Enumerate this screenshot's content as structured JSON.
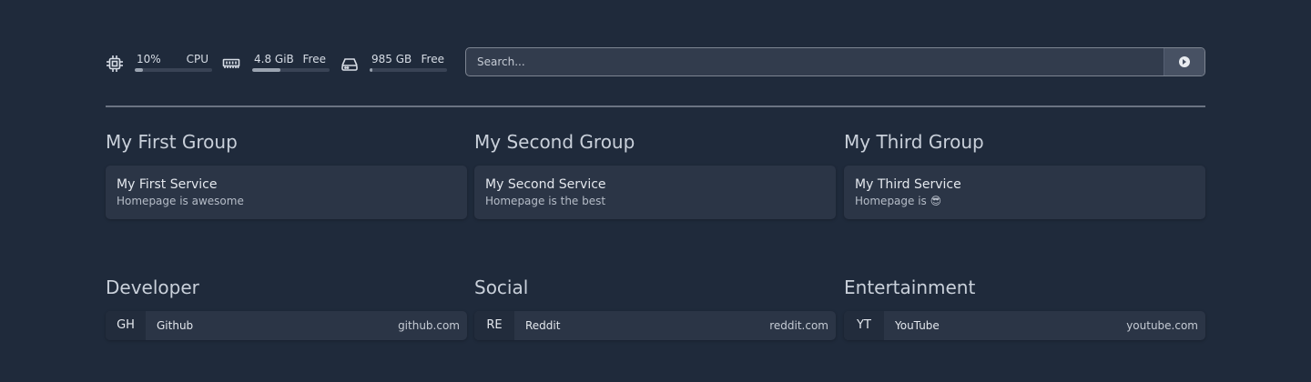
{
  "widgets": {
    "cpu": {
      "icon": "cpu-icon",
      "value": "10%",
      "label": "CPU",
      "fraction": 0.1
    },
    "memory": {
      "icon": "memory-icon",
      "value": "4.8 GiB",
      "label": "Free",
      "fraction": 0.36
    },
    "disk": {
      "icon": "disk-icon",
      "value": "985 GB",
      "label": "Free",
      "fraction": 0.03
    }
  },
  "search": {
    "placeholder": "Search...",
    "button_icon": "search-provider-icon"
  },
  "service_groups": [
    {
      "title": "My First Group",
      "services": [
        {
          "name": "My First Service",
          "description": "Homepage is awesome"
        }
      ]
    },
    {
      "title": "My Second Group",
      "services": [
        {
          "name": "My Second Service",
          "description": "Homepage is the best"
        }
      ]
    },
    {
      "title": "My Third Group",
      "services": [
        {
          "name": "My Third Service",
          "description": "Homepage is 😎"
        }
      ]
    }
  ],
  "bookmark_groups": [
    {
      "title": "Developer",
      "bookmarks": [
        {
          "abbr": "GH",
          "name": "Github",
          "url": "github.com"
        }
      ]
    },
    {
      "title": "Social",
      "bookmarks": [
        {
          "abbr": "RE",
          "name": "Reddit",
          "url": "reddit.com"
        }
      ]
    },
    {
      "title": "Entertainment",
      "bookmarks": [
        {
          "abbr": "YT",
          "name": "YouTube",
          "url": "youtube.com"
        }
      ]
    }
  ],
  "colors": {
    "background": "#1f2a3b",
    "card": "#2b3546",
    "bar_track": "#394355",
    "bar_fill": "#9aa3b0"
  }
}
